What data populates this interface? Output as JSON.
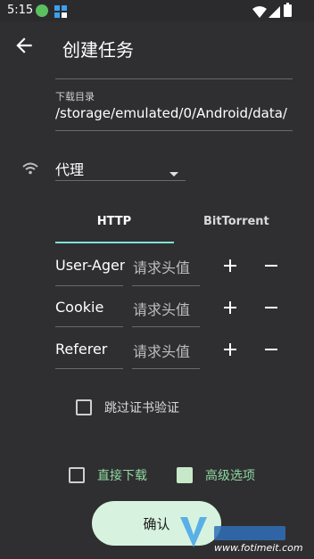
{
  "status_bar": {
    "time": "5:15"
  },
  "app_bar": {
    "title": "创建任务"
  },
  "download_dir": {
    "label": "下载目录",
    "value": "/storage/emulated/0/Android/data/"
  },
  "proxy": {
    "label": "代理"
  },
  "tabs": [
    {
      "label": "HTTP",
      "active": true
    },
    {
      "label": "BitTorrent",
      "active": false
    }
  ],
  "headers": [
    {
      "name": "User-Agen",
      "value_placeholder": "请求头值"
    },
    {
      "name": "Cookie",
      "value_placeholder": "请求头值"
    },
    {
      "name": "Referer",
      "value_placeholder": "请求头值"
    }
  ],
  "skip_cert": {
    "label": "跳过证书验证",
    "checked": false
  },
  "direct_download": {
    "label": "直接下载",
    "checked": false
  },
  "advanced_options": {
    "label": "高级选项",
    "checked": true
  },
  "confirm_button": {
    "label": "确认"
  },
  "watermark": {
    "text": "www.fotimeit.com"
  },
  "colors": {
    "background": "#2f2f31",
    "accent": "#7fe3d3",
    "confirm_bg": "#d7f3df",
    "green_label": "#8fd8a0"
  }
}
